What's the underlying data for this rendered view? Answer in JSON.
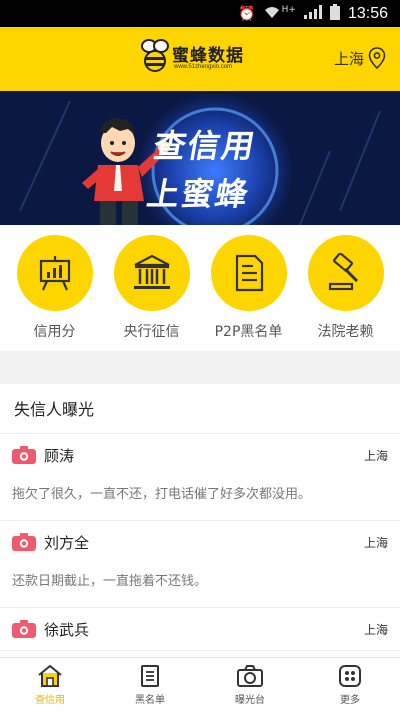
{
  "status_bar": {
    "time": "13:56",
    "network": "H+"
  },
  "header": {
    "brand_name": "蜜蜂数据",
    "brand_url": "www.51zhengxin.com",
    "city": "上海"
  },
  "banner": {
    "line1": "查信用",
    "line2": "上蜜蜂"
  },
  "categories": [
    {
      "label": "信用分",
      "icon": "presentation-chart-icon"
    },
    {
      "label": "央行征信",
      "icon": "bank-building-icon"
    },
    {
      "label": "P2P黑名单",
      "icon": "document-icon"
    },
    {
      "label": "法院老赖",
      "icon": "gavel-icon"
    }
  ],
  "section_title": "失信人曝光",
  "entries": [
    {
      "name": "顾涛",
      "city": "上海",
      "desc": "拖欠了很久，一直不还，打电话催了好多次都没用。"
    },
    {
      "name": "刘方全",
      "city": "上海",
      "desc": "还款日期截止，一直拖着不还钱。"
    },
    {
      "name": "徐武兵",
      "city": "上海",
      "desc": ""
    }
  ],
  "tabs": [
    {
      "label": "查信用",
      "icon": "home-icon",
      "active": true
    },
    {
      "label": "黑名单",
      "icon": "list-doc-icon",
      "active": false
    },
    {
      "label": "曝光台",
      "icon": "camera-icon",
      "active": false
    },
    {
      "label": "更多",
      "icon": "grid-icon",
      "active": false
    }
  ],
  "colors": {
    "accent": "#ffd500",
    "active_tab": "#f0b400",
    "camera_icon": "#f05a6e",
    "banner_bg": "#0b1844"
  }
}
